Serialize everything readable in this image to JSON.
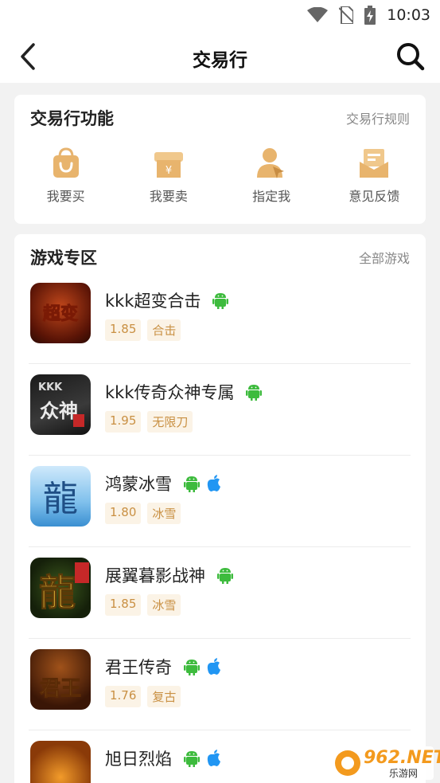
{
  "status_bar": {
    "time": "10:03",
    "icons": [
      "wifi-icon",
      "no-sim-icon",
      "battery-charging-icon"
    ]
  },
  "nav": {
    "title": "交易行",
    "back_icon": "back-arrow-icon",
    "search_icon": "search-icon"
  },
  "functions": {
    "title": "交易行功能",
    "rules_link": "交易行规则",
    "items": [
      {
        "label": "我要买",
        "icon": "shopping-bag-icon"
      },
      {
        "label": "我要卖",
        "icon": "store-icon"
      },
      {
        "label": "指定我",
        "icon": "user-pointer-icon"
      },
      {
        "label": "意见反馈",
        "icon": "feedback-mail-icon"
      }
    ]
  },
  "games": {
    "title": "游戏专区",
    "all_link": "全部游戏",
    "items": [
      {
        "name": "kkk超变合击",
        "platforms": [
          "android"
        ],
        "tags": [
          "1.85",
          "合击"
        ],
        "icon_text": "超变"
      },
      {
        "name": "kkk传奇众神专属",
        "platforms": [
          "android"
        ],
        "tags": [
          "1.95",
          "无限刀"
        ],
        "icon_text": "众神"
      },
      {
        "name": "鸿蒙冰雪",
        "platforms": [
          "android",
          "ios"
        ],
        "tags": [
          "1.80",
          "冰雪"
        ],
        "icon_text": "龍"
      },
      {
        "name": "展翼暮影战神",
        "platforms": [
          "android"
        ],
        "tags": [
          "1.85",
          "冰雪"
        ],
        "icon_text": "龍"
      },
      {
        "name": "君王传奇",
        "platforms": [
          "android",
          "ios"
        ],
        "tags": [
          "1.76",
          "复古"
        ],
        "icon_text": "君王"
      },
      {
        "name": "旭日烈焰",
        "platforms": [
          "android",
          "ios"
        ],
        "tags": [],
        "icon_text": ""
      }
    ]
  },
  "watermark": {
    "text": "962.NET",
    "sub": "乐游网"
  },
  "colors": {
    "accent": "#d9a05b",
    "tag_bg": "#fbf3e6",
    "tag_text": "#c99043",
    "android": "#3dbb3d",
    "ios": "#2196f3"
  }
}
